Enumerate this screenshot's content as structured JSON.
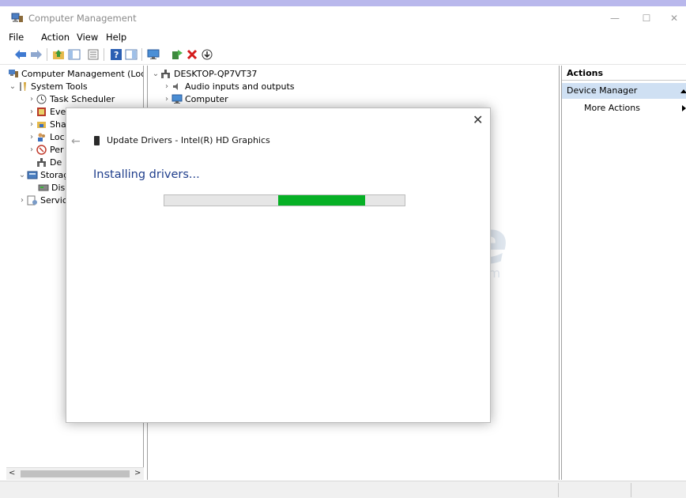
{
  "window": {
    "title": "Computer Management",
    "minimize_glyph": "—",
    "maximize_glyph": "☐",
    "close_glyph": "✕"
  },
  "menu": [
    "File",
    "Action",
    "View",
    "Help"
  ],
  "toolbar_icons": [
    "back-arrow-icon",
    "forward-arrow-icon",
    "folder-up-icon",
    "show-hide-tree-icon",
    "properties-icon",
    "help-icon",
    "console-tree-icon",
    "monitor-icon",
    "enable-device-icon",
    "uninstall-device-icon",
    "update-driver-icon"
  ],
  "left_tree": {
    "root": "Computer Management (Local",
    "system_tools": "System Tools",
    "task_scheduler": "Task Scheduler",
    "event_viewer": "Eve",
    "shared_folders": "Sha",
    "local_users": "Loc",
    "performance": "Per",
    "device_manager": "De",
    "storage": "Storag",
    "disk_management": "Dis",
    "services": "Service"
  },
  "middle_tree": {
    "root": "DESKTOP-QP7VT37",
    "items": [
      "Audio inputs and outputs",
      "Computer"
    ]
  },
  "actions": {
    "header": "Actions",
    "selected": "Device Manager",
    "more": "More Actions"
  },
  "scrollbar": {
    "left_glyph": "<",
    "right_glyph": ">"
  },
  "dialog": {
    "close_glyph": "✕",
    "back_glyph": "←",
    "title": "Update Drivers - Intel(R) HD Graphics",
    "heading": "Installing drivers...",
    "progress_start": 0.475,
    "progress_end": 0.835
  },
  "watermark": {
    "main": "TipsMake",
    "sub": ".com"
  },
  "colors": {
    "accent_bar": "#b9b8ec",
    "progress_fill": "#06b025",
    "heading_blue": "#1f3e8c",
    "selection": "#cfe0f3"
  }
}
